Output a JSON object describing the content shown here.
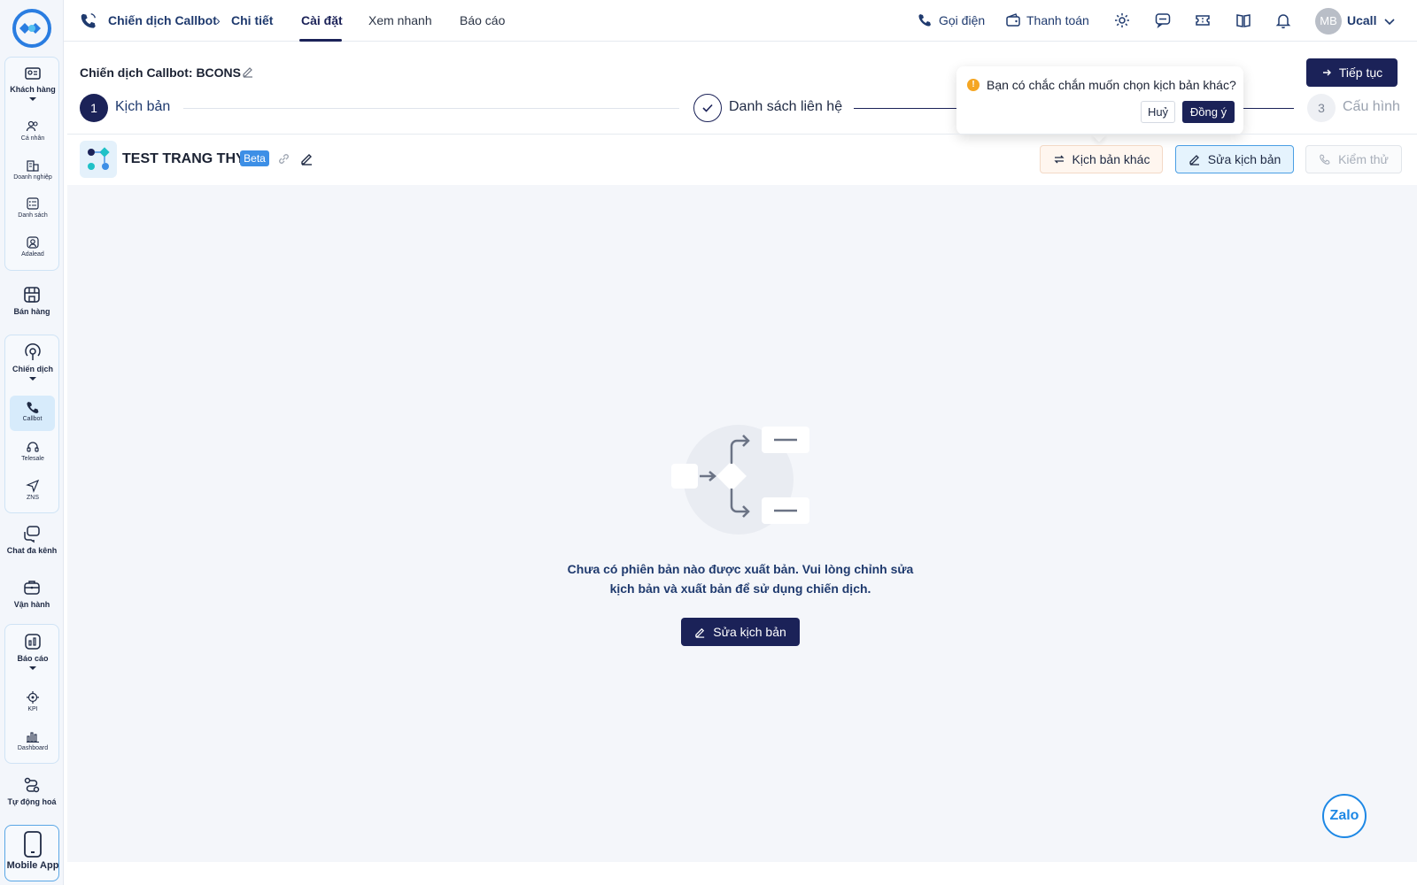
{
  "sidebar": {
    "customers": {
      "label": "Khách hàng",
      "items": [
        "Cá nhân",
        "Doanh nghiệp",
        "Danh sách",
        "Adalead"
      ]
    },
    "sales": {
      "label": "Bán hàng"
    },
    "campaign": {
      "label": "Chiến dịch",
      "items": [
        "Callbot",
        "Telesale",
        "ZNS"
      ]
    },
    "omnichat": {
      "label": "Chat đa kênh"
    },
    "operation": {
      "label": "Vận hành"
    },
    "report": {
      "label": "Báo cáo",
      "items": [
        "KPI",
        "Dashboard"
      ]
    },
    "automation": {
      "label": "Tự động hoá"
    },
    "mobile": {
      "label": "Mobile App"
    }
  },
  "topbar": {
    "breadcrumb": [
      "Chiến dịch Callbot",
      "Chi tiết"
    ],
    "tabs": [
      "Cài đặt",
      "Xem nhanh",
      "Báo cáo"
    ],
    "active_tab": "Cài đặt",
    "call_label": "Gọi điện",
    "payment_label": "Thanh toán",
    "avatar_initials": "MB",
    "user_name": "Ucall"
  },
  "header": {
    "campaign_title": "Chiến dịch Callbot: BCONS",
    "continue_label": "Tiếp tục"
  },
  "steps": [
    {
      "number": "1",
      "label": "Kịch bản"
    },
    {
      "number": "",
      "label": "Danh sách liên hệ"
    },
    {
      "number": "3",
      "label": "Cấu hình"
    }
  ],
  "popover": {
    "message": "Bạn có chắc chắn muốn chọn kịch bản khác?",
    "cancel_label": "Huỷ",
    "confirm_label": "Đồng ý"
  },
  "script": {
    "name": "TEST TRANG THY",
    "badge": "Beta",
    "other_script_label": "Kịch bản khác",
    "edit_script_label": "Sửa kịch bản",
    "test_label": "Kiểm thử"
  },
  "empty_state": {
    "message": "Chưa có phiên bản nào được xuất bản. Vui lòng chỉnh sửa kịch bản và xuất bản để sử dụng chiến dịch.",
    "button_label": "Sửa kịch bản"
  },
  "floating": {
    "zalo_label": "Zalo"
  },
  "colors": {
    "primary": "#1b2258",
    "accent": "#3d8fe6",
    "warning": "#f5a623",
    "canvas": "#f4f6fa"
  }
}
